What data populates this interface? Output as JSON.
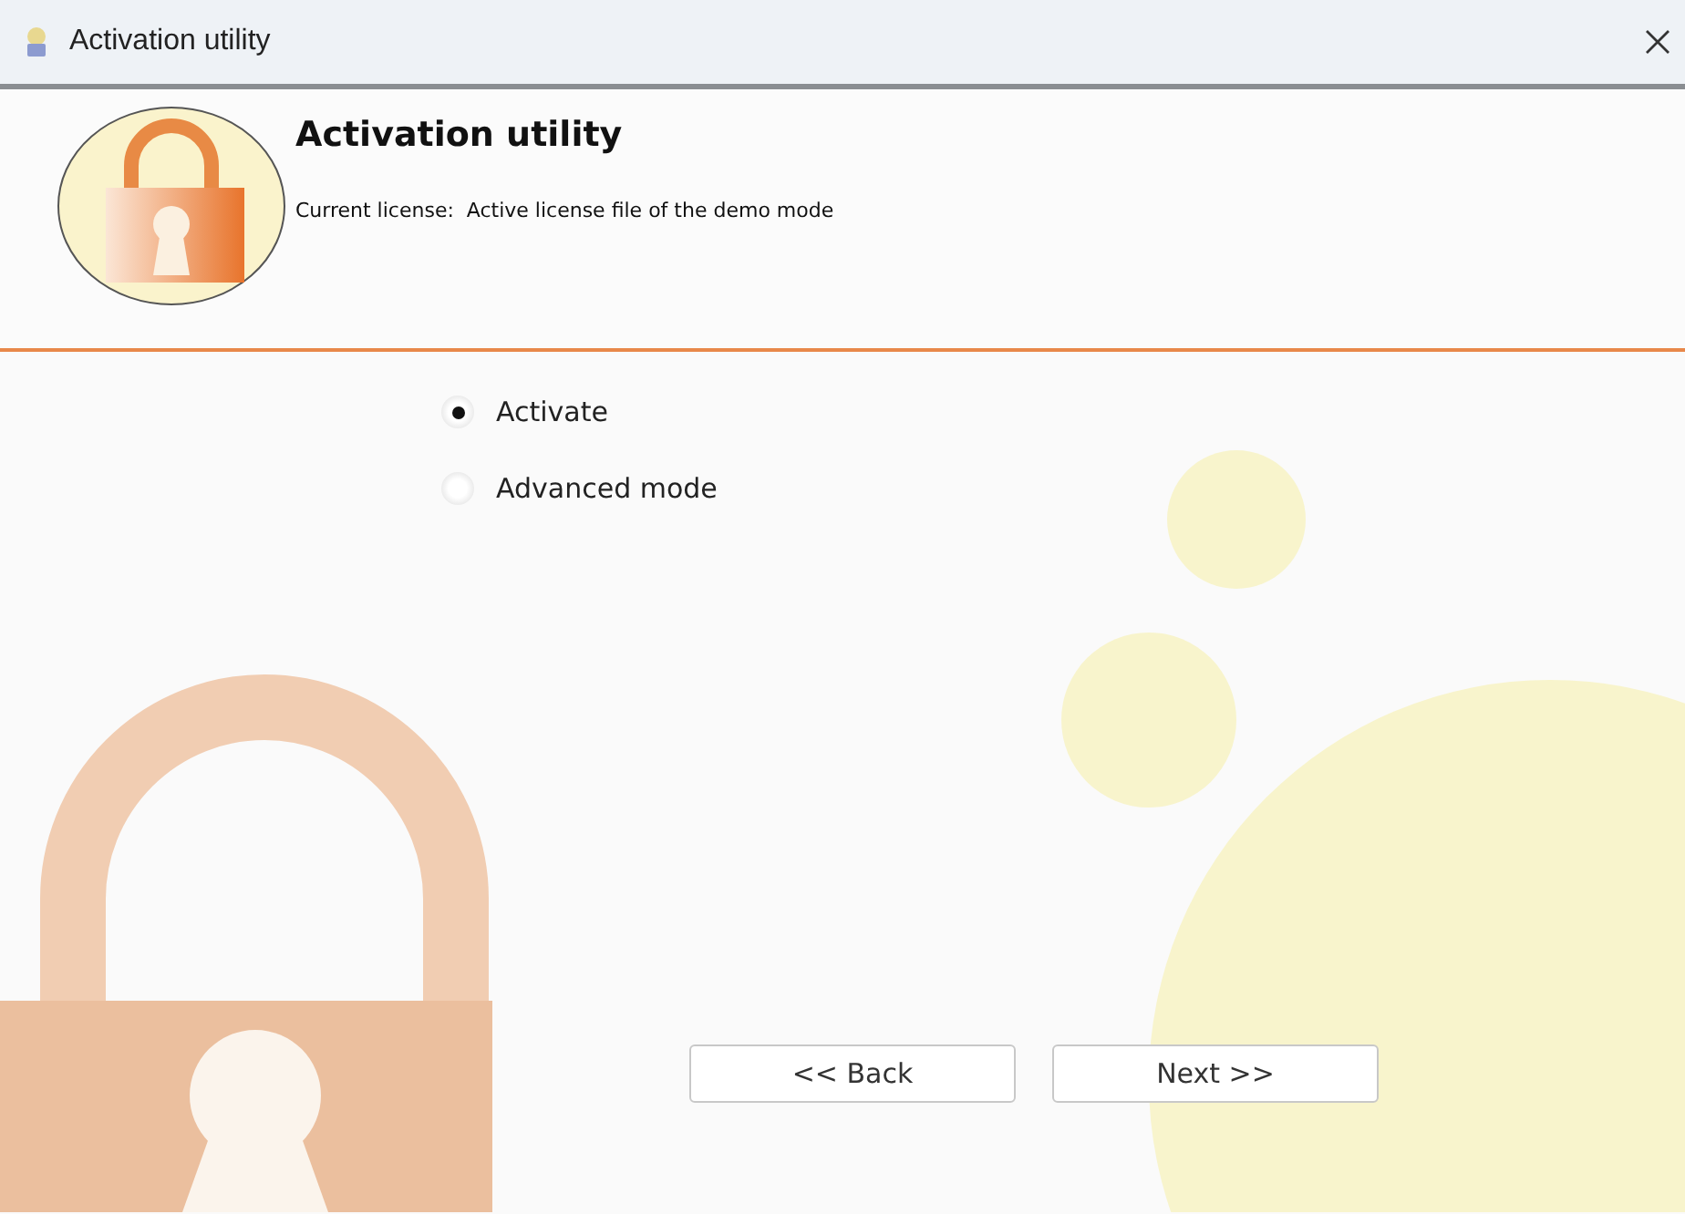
{
  "window": {
    "title": "Activation utility"
  },
  "header": {
    "title": "Activation utility",
    "subtitle": "Current license:  Active license file of the demo mode"
  },
  "options": [
    {
      "label": "Activate",
      "selected": true
    },
    {
      "label": "Advanced mode",
      "selected": false
    }
  ],
  "buttons": [
    "<< Back",
    "Next >>"
  ]
}
